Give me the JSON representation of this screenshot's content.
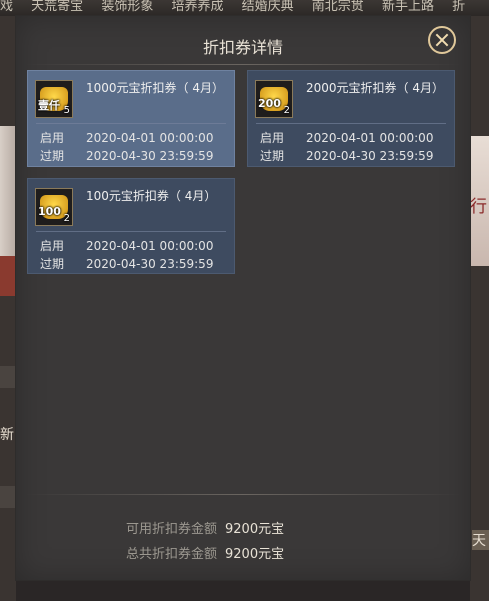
{
  "background": {
    "topbar_items": [
      "戏",
      "天荒寄宝",
      "装饰形象",
      "培养养成",
      "结婚庆典",
      "南北宗贯",
      "新手上路",
      "折"
    ],
    "left_label": "新",
    "right_label": "行",
    "right_label2": "天"
  },
  "dialog": {
    "title": "折扣券详情",
    "cards": [
      {
        "name": "1000元宝折扣券（ 4月）",
        "icon_text": "壹仟",
        "count": "5",
        "start_label": "启用",
        "start": "2020-04-01 00:00:00",
        "end_label": "过期",
        "end": "2020-04-30 23:59:59"
      },
      {
        "name": "2000元宝折扣券（ 4月）",
        "icon_text": "200",
        "count": "2",
        "start_label": "启用",
        "start": "2020-04-01 00:00:00",
        "end_label": "过期",
        "end": "2020-04-30 23:59:59"
      },
      {
        "name": "100元宝折扣券（ 4月）",
        "icon_text": "100",
        "count": "2",
        "start_label": "启用",
        "start": "2020-04-01 00:00:00",
        "end_label": "过期",
        "end": "2020-04-30 23:59:59"
      }
    ],
    "summary": {
      "available_label": "可用折扣券金额",
      "available_value": "9200元宝",
      "total_label": "总共折扣券金额",
      "total_value": "9200元宝"
    }
  },
  "colors": {
    "card_bg": "#3e4b60",
    "card_selected": "#5a6d8a",
    "panel_bg": "#3a3838",
    "accent": "#e0c89a"
  }
}
